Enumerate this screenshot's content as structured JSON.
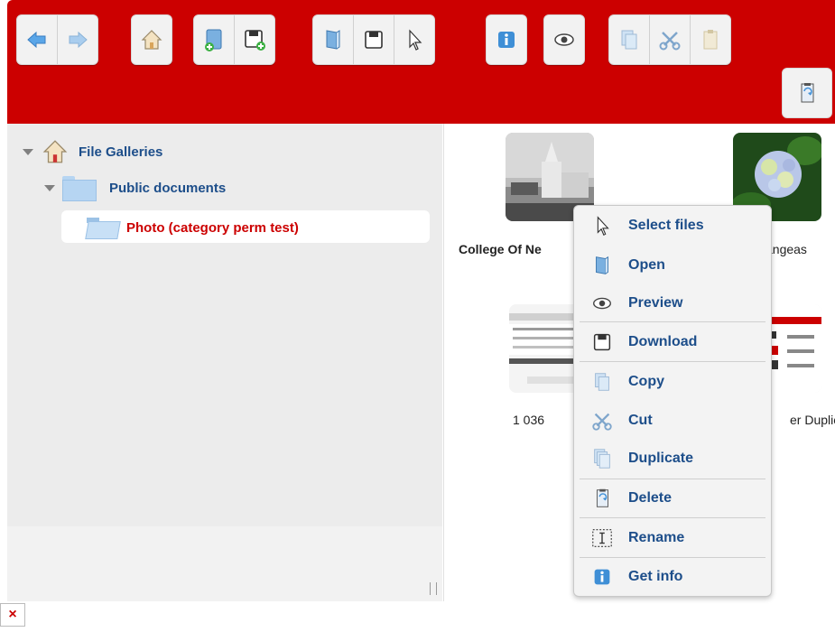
{
  "toolbar": {
    "groups": [
      {
        "name": "navigation",
        "buttons": [
          "back-icon",
          "forward-icon"
        ]
      },
      {
        "name": "home",
        "buttons": [
          "home-icon"
        ]
      },
      {
        "name": "files",
        "buttons": [
          "new-file-icon",
          "save-add-icon"
        ]
      },
      {
        "name": "edit",
        "buttons": [
          "open-icon",
          "save-icon",
          "select-icon"
        ]
      },
      {
        "name": "info",
        "buttons": [
          "info-icon"
        ]
      },
      {
        "name": "view",
        "buttons": [
          "eye-icon"
        ]
      },
      {
        "name": "clipboard",
        "buttons": [
          "copy-icon",
          "cut-icon",
          "paste-icon"
        ]
      }
    ],
    "extra": [
      "delete-icon"
    ],
    "color": "#cc0000"
  },
  "tree": {
    "root_label": "File Galleries",
    "child_label": "Public documents",
    "selected_label": "Photo (category perm test)",
    "selected_color": "#cc0000"
  },
  "files": {
    "items": [
      {
        "name": "College Of Ne"
      },
      {
        "name": "angeas"
      },
      {
        "name": "1 036"
      },
      {
        "name": "er Duplic"
      }
    ]
  },
  "context_menu": {
    "items": [
      {
        "label": "Select files",
        "icon": "select-icon"
      },
      {
        "label": "Open",
        "icon": "open-icon"
      },
      {
        "label": "Preview",
        "icon": "eye-icon"
      },
      {
        "label": "Download",
        "icon": "save-icon"
      },
      {
        "label": "Copy",
        "icon": "copy-icon"
      },
      {
        "label": "Cut",
        "icon": "cut-icon"
      },
      {
        "label": "Duplicate",
        "icon": "duplicate-icon"
      },
      {
        "label": "Delete",
        "icon": "delete-icon"
      },
      {
        "label": "Rename",
        "icon": "rename-icon"
      },
      {
        "label": "Get info",
        "icon": "info-icon"
      }
    ]
  },
  "footer": {
    "broken_icon": "broken-image-icon"
  }
}
